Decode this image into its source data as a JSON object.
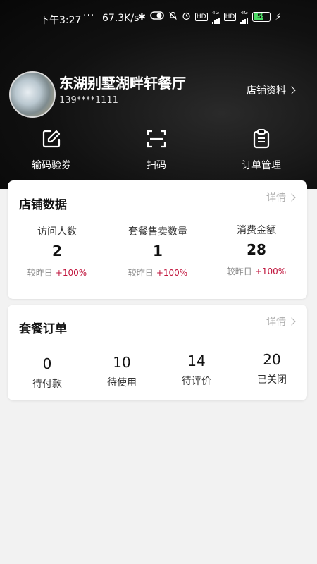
{
  "status_bar": {
    "time": "下午3:27",
    "dots": "···",
    "speed": "67.3K/s",
    "hd1": "HD",
    "hd2": "HD",
    "net1": "4G",
    "net2": "4G",
    "battery": "55"
  },
  "store": {
    "name": "东湖别墅湖畔轩餐厅",
    "phone": "139****1111",
    "info_link": "店铺资料"
  },
  "quick_actions": [
    {
      "label": "输码验券",
      "icon": "edit-icon"
    },
    {
      "label": "扫码",
      "icon": "scan-icon"
    },
    {
      "label": "订单管理",
      "icon": "clipboard-icon"
    }
  ],
  "store_data": {
    "title": "店铺数据",
    "detail": "详情",
    "compare_label": "较昨日",
    "stats": [
      {
        "label": "访问人数",
        "value": "2",
        "change": "+100%"
      },
      {
        "label": "套餐售卖数量",
        "value": "1",
        "change": "+100%"
      },
      {
        "label": "消费金额",
        "value": "28",
        "change": "+100%"
      }
    ]
  },
  "package_orders": {
    "title": "套餐订单",
    "detail": "详情",
    "items": [
      {
        "label": "待付款",
        "value": "0"
      },
      {
        "label": "待使用",
        "value": "10"
      },
      {
        "label": "待评价",
        "value": "14"
      },
      {
        "label": "已关闭",
        "value": "20"
      }
    ]
  },
  "colors": {
    "header_bg": "#111111",
    "accent_up": "#c0143c",
    "page_bg": "#f2f2f2"
  }
}
